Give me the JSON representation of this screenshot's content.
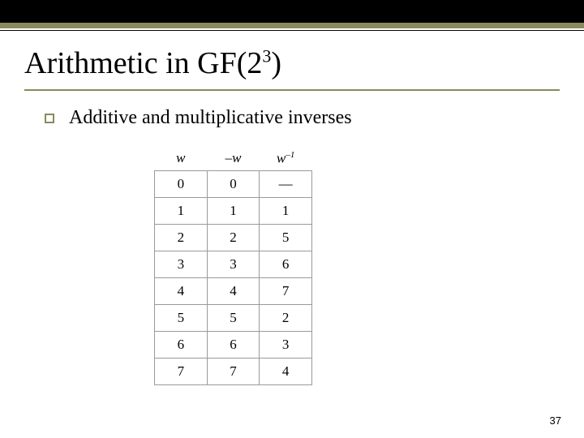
{
  "title": {
    "prefix": "Arithmetic in GF(2",
    "exp": "3",
    "suffix": ")"
  },
  "bullet": "Additive and multiplicative inverses",
  "table": {
    "headers": {
      "w": "w",
      "neg_w": "–w",
      "inv_w_base": "w",
      "inv_w_exp": "–1"
    },
    "rows": [
      {
        "w": "0",
        "neg": "0",
        "inv": "—"
      },
      {
        "w": "1",
        "neg": "1",
        "inv": "1"
      },
      {
        "w": "2",
        "neg": "2",
        "inv": "5"
      },
      {
        "w": "3",
        "neg": "3",
        "inv": "6"
      },
      {
        "w": "4",
        "neg": "4",
        "inv": "7"
      },
      {
        "w": "5",
        "neg": "5",
        "inv": "2"
      },
      {
        "w": "6",
        "neg": "6",
        "inv": "3"
      },
      {
        "w": "7",
        "neg": "7",
        "inv": "4"
      }
    ]
  },
  "page_number": "37",
  "chart_data": {
    "type": "table",
    "title": "Additive and multiplicative inverses in GF(2^3)",
    "columns": [
      "w",
      "-w",
      "w^-1"
    ],
    "rows": [
      [
        0,
        0,
        null
      ],
      [
        1,
        1,
        1
      ],
      [
        2,
        2,
        5
      ],
      [
        3,
        3,
        6
      ],
      [
        4,
        4,
        7
      ],
      [
        5,
        5,
        2
      ],
      [
        6,
        6,
        3
      ],
      [
        7,
        7,
        4
      ]
    ]
  }
}
